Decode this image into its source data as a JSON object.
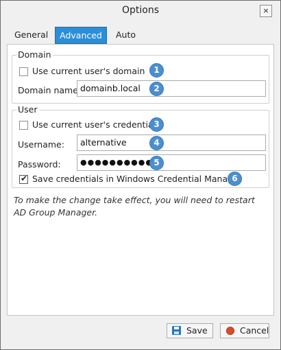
{
  "window": {
    "title": "Options",
    "close_glyph": "×"
  },
  "tabs": [
    {
      "label": "General",
      "active": false
    },
    {
      "label": "Advanced",
      "active": true
    },
    {
      "label": "Auto updates",
      "active": false
    }
  ],
  "domain_group": {
    "label": "Domain",
    "use_current_domain_label": "Use current user's domain",
    "use_current_domain_checked": false,
    "domain_name_label": "Domain name:",
    "domain_name_value": "domainb.local"
  },
  "user_group": {
    "label": "User",
    "use_current_credentials_label": "Use current user's credentials",
    "use_current_credentials_checked": false,
    "username_label": "Username:",
    "username_value": "alternative",
    "password_label": "Password:",
    "password_value": "●●●●●●●●●●●",
    "save_credentials_label": "Save credentials in Windows Credential Manager",
    "save_credentials_checked": true,
    "checkmark_glyph": "✔"
  },
  "badges": [
    "1",
    "2",
    "3",
    "4",
    "5",
    "6"
  ],
  "note": "To make the change take effect, you will need to restart AD Group Manager.",
  "buttons": {
    "save_label": "Save",
    "cancel_label": "Cancel"
  },
  "colors": {
    "accent": "#2b8ed8",
    "badge": "#4b8fd0",
    "cancel_icon": "#d94b2b",
    "save_icon": "#2f74b7"
  }
}
